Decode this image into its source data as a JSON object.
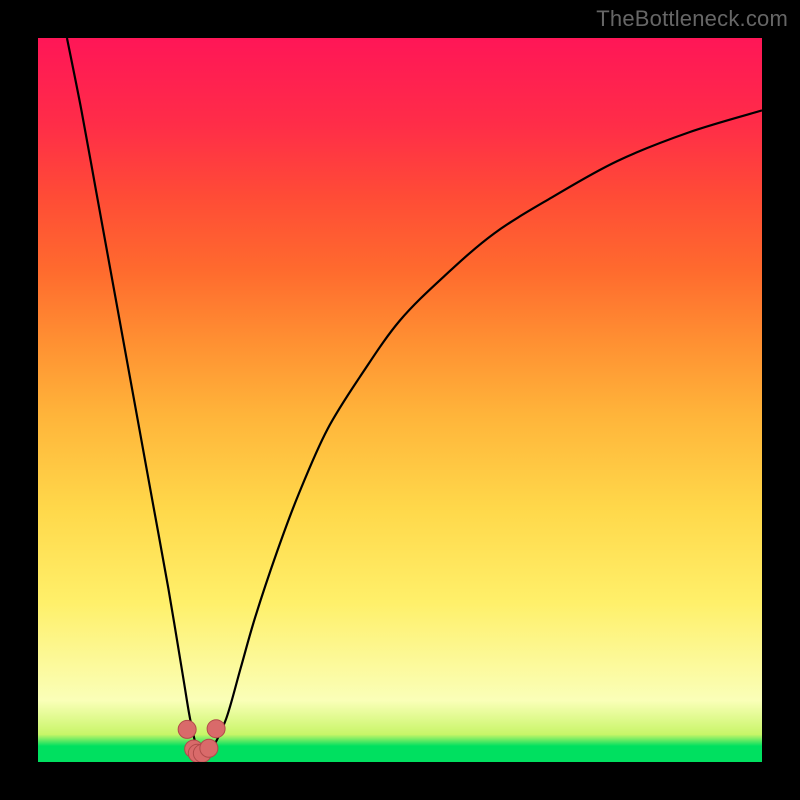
{
  "watermark": {
    "text": "TheBottleneck.com"
  },
  "colors": {
    "curve": "#000000",
    "marker_fill": "#d96a6a",
    "marker_stroke": "#b14a4a"
  },
  "chart_data": {
    "type": "line",
    "title": "",
    "xlabel": "",
    "ylabel": "",
    "xlim": [
      0,
      100
    ],
    "ylim": [
      0,
      100
    ],
    "grid": false,
    "series": [
      {
        "name": "bottleneck-curve",
        "x": [
          4,
          6,
          8,
          10,
          12,
          14,
          16,
          18,
          20,
          21,
          22,
          23,
          24,
          26,
          28,
          30,
          33,
          36,
          40,
          45,
          50,
          56,
          63,
          71,
          80,
          90,
          100
        ],
        "y": [
          100,
          90,
          79,
          68,
          57,
          46,
          35,
          24,
          12,
          6,
          1.8,
          1.2,
          1.8,
          6,
          13,
          20,
          29,
          37,
          46,
          54,
          61,
          67,
          73,
          78,
          83,
          87,
          90
        ]
      }
    ],
    "markers": {
      "name": "valley-points",
      "x": [
        20.6,
        21.5,
        22.0,
        22.7,
        23.6,
        24.6
      ],
      "y": [
        4.5,
        1.8,
        1.2,
        1.2,
        1.9,
        4.6
      ],
      "size": 9
    }
  }
}
